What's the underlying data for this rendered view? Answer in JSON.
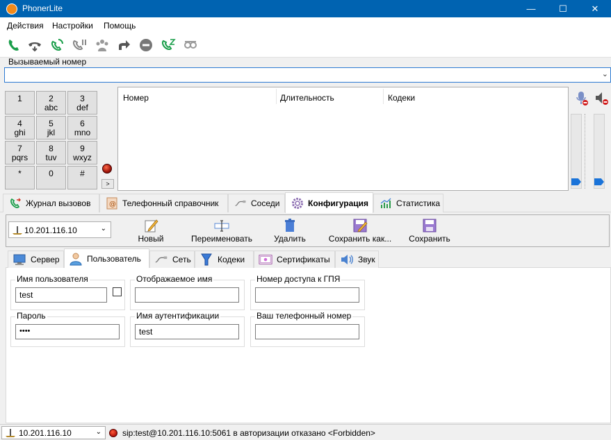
{
  "window": {
    "title": "PhonerLite",
    "minimize": "—",
    "maximize": "☐",
    "close": "✕"
  },
  "menu": [
    "Действия",
    "Настройки",
    "Помощь"
  ],
  "toolbar_icons": [
    "call-icon",
    "hangup-icon",
    "callback-icon",
    "hold-icon",
    "conference-icon",
    "forward-icon",
    "reject-icon",
    "pickup-icon",
    "mute-icon"
  ],
  "dial": {
    "label": "Вызываемый номер",
    "value": ""
  },
  "keypad": [
    {
      "d": "1",
      "l": ""
    },
    {
      "d": "2",
      "l": "abc"
    },
    {
      "d": "3",
      "l": "def"
    },
    {
      "d": "4",
      "l": "ghi"
    },
    {
      "d": "5",
      "l": "jkl"
    },
    {
      "d": "6",
      "l": "mno"
    },
    {
      "d": "7",
      "l": "pqrs"
    },
    {
      "d": "8",
      "l": "tuv"
    },
    {
      "d": "9",
      "l": "wxyz"
    },
    {
      "d": "*",
      "l": ""
    },
    {
      "d": "0",
      "l": ""
    },
    {
      "d": "#",
      "l": ""
    }
  ],
  "keypad_more": ">",
  "calls": {
    "headers": [
      "Номер",
      "Длительность",
      "Кодеки"
    ]
  },
  "main_tabs": [
    "Журнал вызовов",
    "Телефонный справочник",
    "Соседи",
    "Конфигурация",
    "Статистика"
  ],
  "config": {
    "profile": "10.201.116.10",
    "buttons": [
      "Новый",
      "Переименовать",
      "Удалить",
      "Сохранить как...",
      "Сохранить"
    ]
  },
  "sub_tabs": [
    "Сервер",
    "Пользователь",
    "Сеть",
    "Кодеки",
    "Сертификаты",
    "Звук"
  ],
  "user": {
    "username_label": "Имя пользователя",
    "username": "test",
    "display_label": "Отображаемое имя",
    "display": "",
    "emergency_label": "Номер доступа к ГПЯ",
    "emergency": "",
    "password_label": "Пароль",
    "password": "••••",
    "auth_label": "Имя аутентификации",
    "auth": "test",
    "phone_label": "Ваш телефонный номер",
    "phone": ""
  },
  "status": {
    "profile": "10.201.116.10",
    "message": "sip:test@10.201.116.10:5061 в авторизации отказано <Forbidden>"
  }
}
